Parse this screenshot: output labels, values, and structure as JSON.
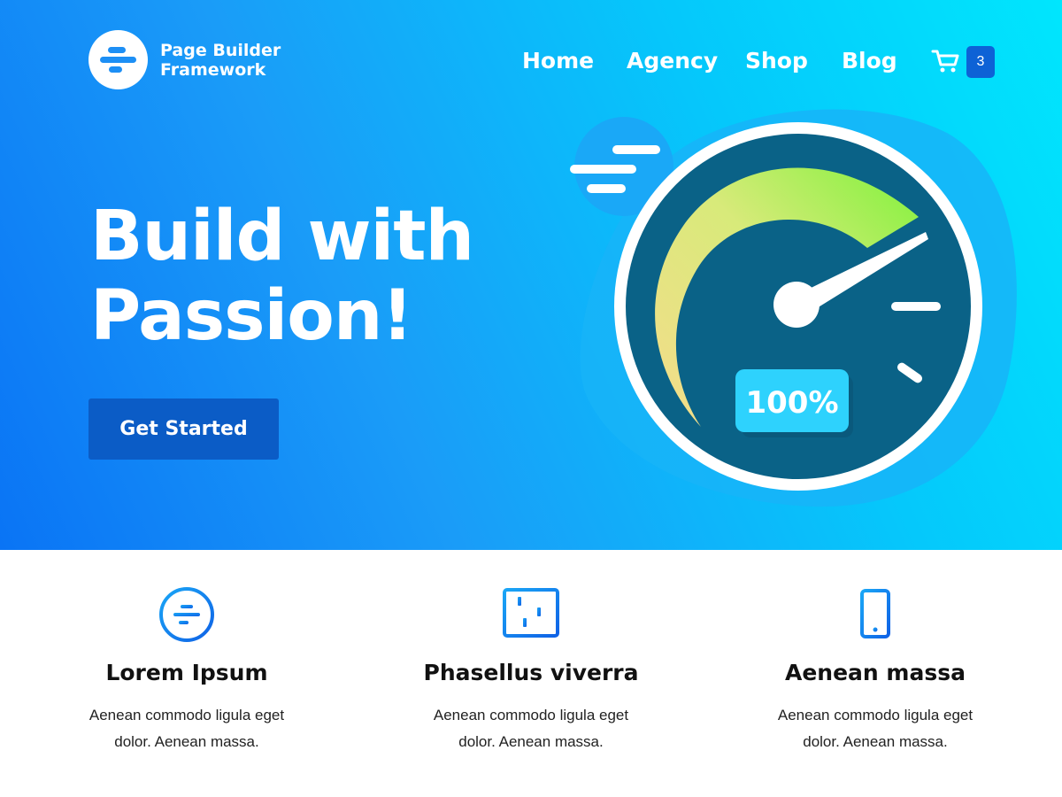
{
  "brand": {
    "line1": "Page Builder",
    "line2": "Framework",
    "logo_icon": "stripes-logo-icon",
    "color": "#1d8ff5"
  },
  "nav": {
    "items": [
      {
        "label": "Home"
      },
      {
        "label": "Agency"
      },
      {
        "label": "Shop"
      },
      {
        "label": "Blog"
      }
    ]
  },
  "cart": {
    "icon": "cart-icon",
    "count": "3"
  },
  "hero": {
    "title_line1": "Build with",
    "title_line2": "Passion!",
    "cta_label": "Get Started",
    "gauge_value": "100%",
    "gradient": [
      "#0a74f5",
      "#00e6fd"
    ]
  },
  "features": [
    {
      "icon": "stripes-circle-icon",
      "title": "Lorem Ipsum",
      "text_line1": "Aenean commodo ligula eget",
      "text_line2": "dolor. Aenean massa."
    },
    {
      "icon": "sliders-icon",
      "title": "Phasellus viverra",
      "text_line1": "Aenean commodo ligula eget",
      "text_line2": "dolor. Aenean massa."
    },
    {
      "icon": "smartphone-icon",
      "title": "Aenean massa",
      "text_line1": "Aenean commodo ligula eget",
      "text_line2": "dolor. Aenean massa."
    }
  ]
}
